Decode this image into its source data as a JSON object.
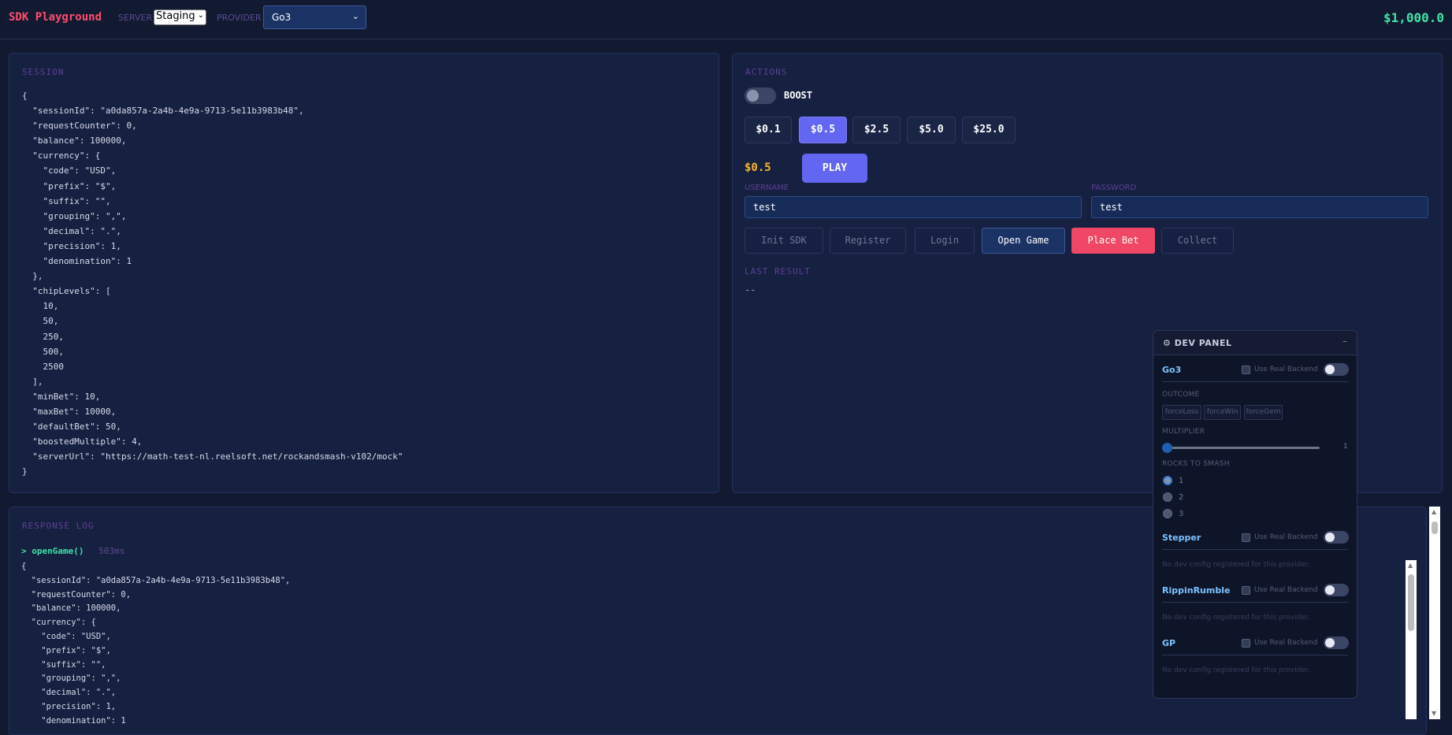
{
  "header": {
    "brand": "SDK Playground",
    "server_label": "SERVER",
    "server_value": "Staging",
    "provider_label": "PROVIDER",
    "provider_value": "Go3",
    "balance": "$1,000.0"
  },
  "session": {
    "title": "SESSION",
    "json": "{\n  \"sessionId\": \"a0da857a-2a4b-4e9a-9713-5e11b3983b48\",\n  \"requestCounter\": 0,\n  \"balance\": 100000,\n  \"currency\": {\n    \"code\": \"USD\",\n    \"prefix\": \"$\",\n    \"suffix\": \"\",\n    \"grouping\": \",\",\n    \"decimal\": \".\",\n    \"precision\": 1,\n    \"denomination\": 1\n  },\n  \"chipLevels\": [\n    10,\n    50,\n    250,\n    500,\n    2500\n  ],\n  \"minBet\": 10,\n  \"maxBet\": 10000,\n  \"defaultBet\": 50,\n  \"boostedMultiple\": 4,\n  \"serverUrl\": \"https://math-test-nl.reelsoft.net/rockandsmash-v102/mock\"\n}"
  },
  "actions": {
    "title": "ACTIONS",
    "boost_label": "BOOST",
    "chips": [
      "$0.1",
      "$0.5",
      "$2.5",
      "$5.0",
      "$25.0"
    ],
    "selected_chip": "$0.5",
    "bet_amount": "$0.5",
    "play_label": "PLAY",
    "username_label": "USERNAME",
    "username_value": "test",
    "password_label": "PASSWORD",
    "password_value": "test",
    "buttons": {
      "init": "Init SDK",
      "register": "Register",
      "login": "Login",
      "open": "Open Game",
      "place": "Place Bet",
      "collect": "Collect"
    },
    "last_result_label": "LAST RESULT",
    "last_result_value": "--"
  },
  "response_log": {
    "title": "RESPONSE LOG",
    "entry_prefix": ">",
    "entry_fn": "openGame()",
    "entry_ms": "503ms",
    "entry_json": "{\n  \"sessionId\": \"a0da857a-2a4b-4e9a-9713-5e11b3983b48\",\n  \"requestCounter\": 0,\n  \"balance\": 100000,\n  \"currency\": {\n    \"code\": \"USD\",\n    \"prefix\": \"$\",\n    \"suffix\": \"\",\n    \"grouping\": \",\",\n    \"decimal\": \".\",\n    \"precision\": 1,\n    \"denomination\": 1"
  },
  "dev_panel": {
    "title": "DEV PANEL",
    "gear_icon": "⚙",
    "minimize_icon": "–",
    "real_backend_label": "Use Real Backend",
    "providers": [
      "Go3",
      "Stepper",
      "RippinRumble",
      "GP"
    ],
    "outcome_label": "OUTCOME",
    "outcome_buttons": [
      "forceLoss",
      "forceWin",
      "forceGem"
    ],
    "multiplier_label": "MULTIPLIER",
    "multiplier_value": "1",
    "rocks_label": "ROCKS TO SMASH",
    "rocks_options": [
      "1",
      "2",
      "3"
    ],
    "rocks_selected": "1",
    "no_config_text": "No dev config registered for this provider."
  },
  "colors": {
    "background": "#111a31",
    "panel": "#162040",
    "accent": "#6366f1",
    "danger": "#ef4765",
    "balance": "#3fe3a6",
    "brand": "#ff4d6d"
  }
}
